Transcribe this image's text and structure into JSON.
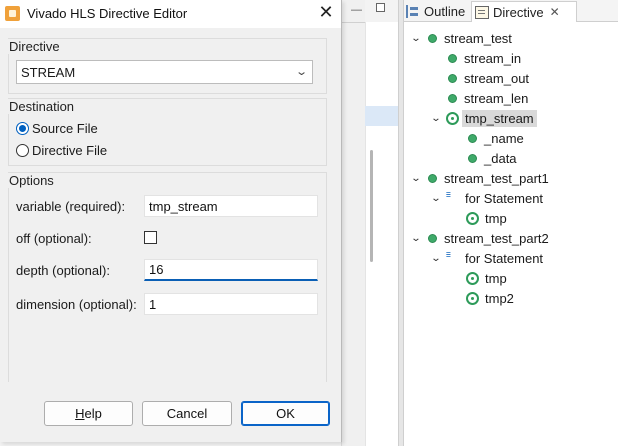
{
  "dialog": {
    "title": "Vivado HLS Directive Editor",
    "close_glyph": "✕",
    "directive_group_label": "Directive",
    "directive_value": "STREAM",
    "destination_group_label": "Destination",
    "destination_options": [
      {
        "label": "Source File",
        "selected": true
      },
      {
        "label": "Directive File",
        "selected": false
      }
    ],
    "options_group_label": "Options",
    "options": {
      "variable": {
        "label": "variable (required):",
        "value": "tmp_stream"
      },
      "off": {
        "label": "off (optional):",
        "checked": false
      },
      "depth": {
        "label": "depth (optional):",
        "value": "16"
      },
      "dimension": {
        "label": "dimension (optional):",
        "value": "1"
      }
    },
    "buttons": {
      "help_mnemonic": "H",
      "help_rest": "elp",
      "cancel": "Cancel",
      "ok": "OK"
    }
  },
  "panel": {
    "tabs": [
      {
        "label": "Outline",
        "icon": "outline-icon",
        "active": false
      },
      {
        "label": "Directive",
        "icon": "directive-icon",
        "active": true
      }
    ],
    "tab_close_glyph": "✕",
    "tree": [
      {
        "label": "stream_test",
        "icon": "function-icon",
        "depth": 0,
        "expanded": true
      },
      {
        "label": "stream_in",
        "icon": "variable-icon",
        "depth": 1
      },
      {
        "label": "stream_out",
        "icon": "variable-icon",
        "depth": 1
      },
      {
        "label": "stream_len",
        "icon": "variable-icon",
        "depth": 1
      },
      {
        "label": "tmp_stream",
        "icon": "class-icon",
        "depth": 1,
        "expanded": true,
        "selected": true
      },
      {
        "label": "_name",
        "icon": "variable-icon",
        "depth": 2
      },
      {
        "label": "_data",
        "icon": "variable-icon",
        "depth": 2
      },
      {
        "label": "stream_test_part1",
        "icon": "function-icon",
        "depth": 0,
        "expanded": true
      },
      {
        "label": "for Statement",
        "icon": "for-loop-icon",
        "depth": 1,
        "expanded": true
      },
      {
        "label": "tmp",
        "icon": "class-icon",
        "depth": 2
      },
      {
        "label": "stream_test_part2",
        "icon": "function-icon",
        "depth": 0,
        "expanded": true
      },
      {
        "label": "for Statement",
        "icon": "for-loop-icon",
        "depth": 1,
        "expanded": true
      },
      {
        "label": "tmp",
        "icon": "class-icon",
        "depth": 2
      },
      {
        "label": "tmp2",
        "icon": "class-icon",
        "depth": 2
      }
    ]
  },
  "colors": {
    "accent": "#0a5fb5",
    "node_green": "#3faa6a",
    "selection_gray": "#d9d9d9"
  }
}
